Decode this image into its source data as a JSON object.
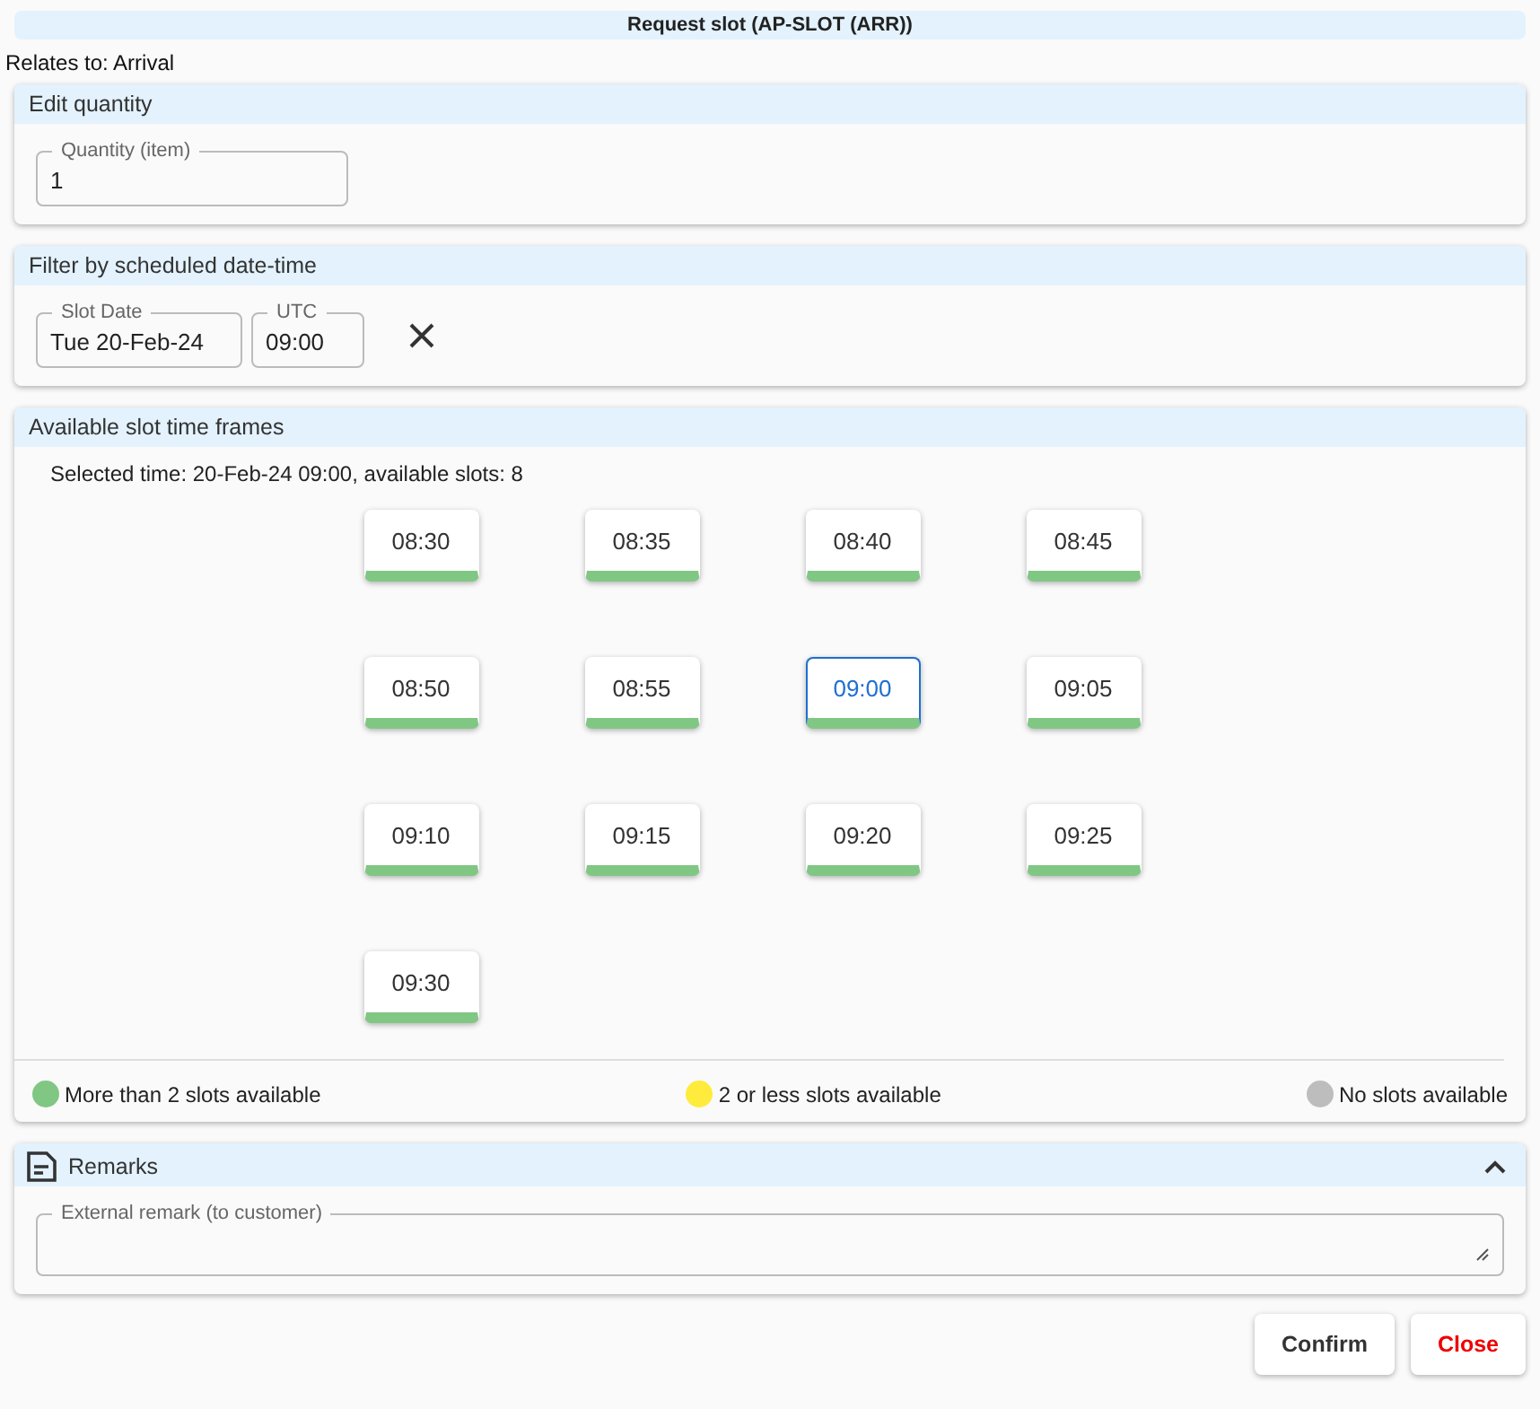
{
  "window": {
    "title": "Request slot (AP-SLOT (ARR))"
  },
  "relates_to": "Relates to: Arrival",
  "quantity_section": {
    "title": "Edit quantity",
    "field": {
      "label": "Quantity (item)",
      "value": "1"
    }
  },
  "filter_section": {
    "title": "Filter by scheduled date-time",
    "date_field": {
      "label": "Slot Date",
      "value": "Tue 20-Feb-24"
    },
    "time_field": {
      "label": "UTC",
      "value": "09:00"
    }
  },
  "slots_section": {
    "title": "Available slot time frames",
    "selected_text": "Selected time: 20-Feb-24 09:00, available slots: 8",
    "slots": [
      {
        "time": "08:30",
        "color": "#81c784",
        "selected": false
      },
      {
        "time": "08:35",
        "color": "#81c784",
        "selected": false
      },
      {
        "time": "08:40",
        "color": "#81c784",
        "selected": false
      },
      {
        "time": "08:45",
        "color": "#81c784",
        "selected": false
      },
      {
        "time": "08:50",
        "color": "#81c784",
        "selected": false
      },
      {
        "time": "08:55",
        "color": "#81c784",
        "selected": false
      },
      {
        "time": "09:00",
        "color": "#81c784",
        "selected": true
      },
      {
        "time": "09:05",
        "color": "#81c784",
        "selected": false
      },
      {
        "time": "09:10",
        "color": "#81c784",
        "selected": false
      },
      {
        "time": "09:15",
        "color": "#81c784",
        "selected": false
      },
      {
        "time": "09:20",
        "color": "#81c784",
        "selected": false
      },
      {
        "time": "09:25",
        "color": "#81c784",
        "selected": false
      },
      {
        "time": "09:30",
        "color": "#81c784",
        "selected": false
      }
    ],
    "legend": [
      {
        "label": "More than 2 slots available",
        "color": "#81c784"
      },
      {
        "label": "2 or less slots available",
        "color": "#ffeb3b"
      },
      {
        "label": "No slots available",
        "color": "#bdbdbd"
      }
    ]
  },
  "remarks_section": {
    "title": "Remarks",
    "expanded": true,
    "field": {
      "label": "External remark (to customer)"
    }
  },
  "buttons": [
    {
      "label": "Confirm",
      "kind": "primary"
    },
    {
      "label": "Close",
      "kind": "danger"
    }
  ]
}
